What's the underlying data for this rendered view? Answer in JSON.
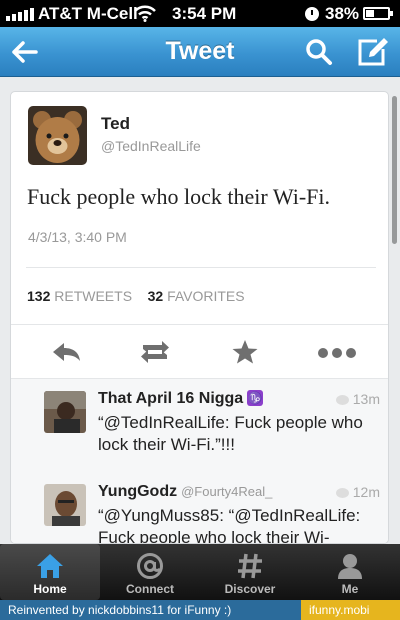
{
  "status_bar": {
    "carrier": "AT&T M-Cell",
    "time": "3:54 PM",
    "battery": "38%",
    "battery_level": 0.38
  },
  "nav": {
    "title": "Tweet",
    "back_icon": "back-arrow-icon",
    "search_icon": "search-icon",
    "compose_icon": "compose-icon"
  },
  "tweet": {
    "author_name": "Ted",
    "author_handle": "@TedInRealLife",
    "text": "Fuck people who lock their Wi-Fi.",
    "date": "4/3/13, 3:40 PM",
    "retweets_count": "132",
    "retweets_label": "RETWEETS",
    "favorites_count": "32",
    "favorites_label": "FAVORITES",
    "actions": [
      "reply-icon",
      "retweet-icon",
      "favorite-icon",
      "more-icon"
    ]
  },
  "replies": [
    {
      "name": "That April 16 Nigga",
      "badge": "♑",
      "handle": "",
      "time": "13m",
      "text": "“@TedInRealLife: Fuck people who lock their Wi-Fi.”!!!"
    },
    {
      "name": "YungGodz",
      "badge": "",
      "handle": "@Fourty4Real_",
      "time": "12m",
      "text": "“@YungMuss85: “@TedInRealLife: Fuck people who lock their Wi-"
    }
  ],
  "tabs": [
    {
      "label": "Home",
      "icon": "home-icon",
      "active": true
    },
    {
      "label": "Connect",
      "icon": "at-icon",
      "active": false
    },
    {
      "label": "Discover",
      "icon": "hashtag-icon",
      "active": false
    },
    {
      "label": "Me",
      "icon": "person-icon",
      "active": false
    }
  ],
  "footer": {
    "left": "Reinvented by nickdobbins11 for iFunny :)",
    "right": "ifunny.mobi"
  },
  "colors": {
    "nav_blue": "#3a93d1",
    "tab_bar": "#1a1a1a",
    "home_icon_blue": "#3aa0e6",
    "footer_blue": "#2b6b9b",
    "footer_yellow": "#e6b51e"
  }
}
